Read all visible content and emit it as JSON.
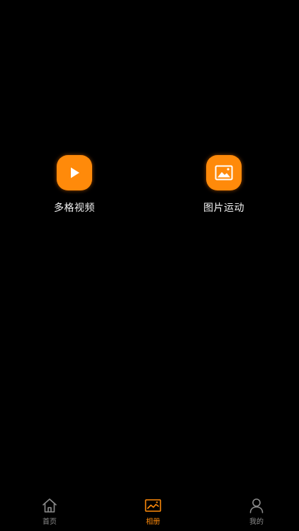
{
  "colors": {
    "accent": "#ff8a0a",
    "background": "#000000",
    "tab_inactive": "#8c8c8c",
    "label_text": "#f2f2f2"
  },
  "features": [
    {
      "label": "多格视频",
      "icon": "play-icon"
    },
    {
      "label": "图片运动",
      "icon": "image-icon"
    }
  ],
  "tabbar": {
    "items": [
      {
        "label": "首页",
        "icon": "home-icon",
        "active": false
      },
      {
        "label": "相册",
        "icon": "album-icon",
        "active": true
      },
      {
        "label": "我的",
        "icon": "profile-icon",
        "active": false
      }
    ]
  }
}
